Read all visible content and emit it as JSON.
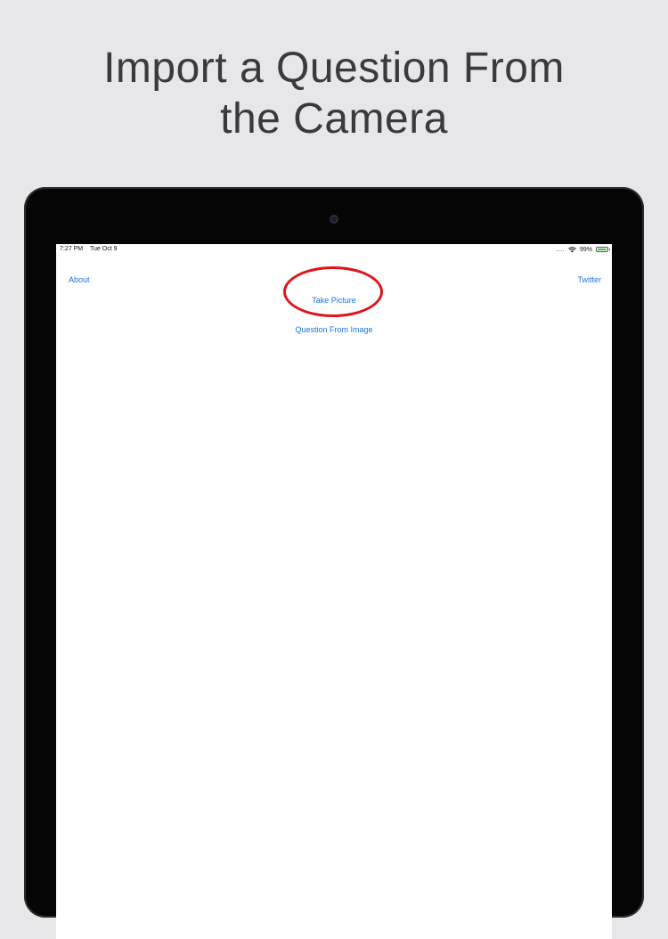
{
  "headline": {
    "line1": "Import a Question From",
    "line2": "the Camera"
  },
  "status_bar": {
    "time": "7:27 PM",
    "date": "Tue Oct 9",
    "dots": "....",
    "battery_percent_label": "99%",
    "battery_level": 0.99,
    "wifi_icon": "wifi-icon",
    "battery_icon": "battery-icon"
  },
  "app": {
    "about_label": "About",
    "twitter_label": "Twitter",
    "take_picture_label": "Take Picture",
    "question_from_image_label": "Question From Image"
  },
  "colors": {
    "page_background": "#e7e6e9",
    "device_bezel": "#050505",
    "link_blue": "#1a73e8",
    "highlight_red": "#e0141c",
    "battery_green": "#3cc13b"
  }
}
